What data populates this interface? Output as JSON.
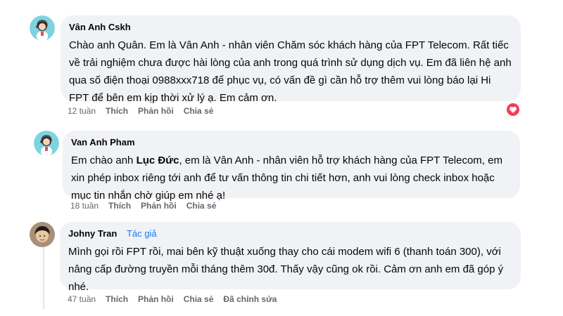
{
  "comments": [
    {
      "author": "Vân Anh Cskh",
      "text": "Chào anh Quân. Em là Vân Anh - nhân viên Chăm sóc khách hàng của FPT Telecom. Rất tiếc về trải nghiệm chưa được hài lòng của anh trong quá trình sử dụng dịch vụ. Em đã liên hệ anh qua số điện thoại 0988xxx718 để phục vụ, có vấn đề gì cần hỗ trợ thêm vui lòng báo lại Hi FPT để bên em kịp thời xử lý ạ. Em cảm ơn.",
      "time": "12 tuần",
      "like": "Thích",
      "reply": "Phản hồi",
      "share": "Chia sẻ",
      "reaction": "heart-icon"
    },
    {
      "author": "Van Anh Pham",
      "text_before": "Em chào anh ",
      "mention": "Lục Đức",
      "text_after": ", em là Vân Anh - nhân viên hỗ trợ khách hàng của FPT Telecom, em xin phép inbox riêng tới anh để tư vấn thông tin chi tiết hơn, anh vui lòng check inbox hoặc mục tin nhắn chờ giúp em nhé ạ!",
      "time": "18 tuần",
      "like": "Thích",
      "reply": "Phản hồi",
      "share": "Chia sẻ"
    },
    {
      "author": "Johny Tran",
      "badge": "Tác giả",
      "text": "Mình gọi rồi FPT rồi, mai bên kỹ thuật xuống thay cho cái modem wifi 6 (thanh toán 300), với nâng cấp đường truyền mỗi tháng thêm 30đ. Thấy vậy cũng ok rồi. Cảm ơn anh em đã góp ý nhé.",
      "time": "47 tuần",
      "like": "Thích",
      "reply": "Phản hồi",
      "share": "Chia sẻ",
      "edited": "Đã chỉnh sửa"
    }
  ],
  "colors": {
    "bubble": "#f0f2f5",
    "action_text": "#65676b",
    "badge": "#1877f2",
    "heart": "#f33e58"
  }
}
